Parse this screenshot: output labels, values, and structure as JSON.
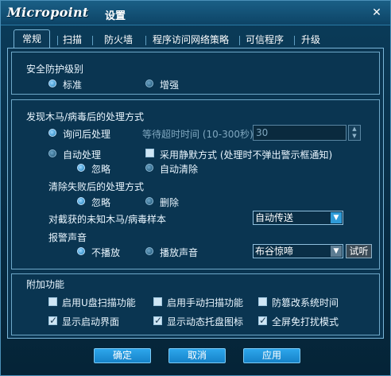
{
  "window": {
    "logo": "Micropoint",
    "title": "设置",
    "close": "✕"
  },
  "tabs": [
    "常规",
    "扫描",
    "防火墙",
    "程序访问网络策略",
    "可信程序",
    "升级"
  ],
  "security_level": {
    "heading": "安全防护级别",
    "options": [
      {
        "label": "标准",
        "selected": true
      },
      {
        "label": "增强",
        "selected": false
      }
    ]
  },
  "trojan_handling": {
    "heading": "发现木马/病毒后的处理方式",
    "ask": {
      "label": "询问后处理",
      "selected": true
    },
    "timeout": {
      "label": "等待超时时间 (10-300秒):",
      "value": "30"
    },
    "auto": {
      "label": "自动处理",
      "selected": false
    },
    "silent": {
      "label": "采用静默方式 (处理时不弹出警示框通知)",
      "checked": false
    },
    "ignore": {
      "label": "忽略",
      "selected": true
    },
    "auto_clear": {
      "label": "自动清除",
      "selected": false
    },
    "fail_heading": "清除失败后的处理方式",
    "fail_ignore": {
      "label": "忽略",
      "selected": true
    },
    "fail_delete": {
      "label": "删除",
      "selected": false
    },
    "unknown_label": "对截获的未知木马/病毒样本",
    "unknown_select": "自动传送",
    "alarm_heading": "报警声音",
    "no_sound": {
      "label": "不播放",
      "selected": true
    },
    "play_sound": {
      "label": "播放声音",
      "selected": false
    },
    "sound_select": "布谷惊啼",
    "listen": "试听"
  },
  "extras": {
    "heading": "附加功能",
    "items": [
      {
        "label": "启用U盘扫描功能",
        "checked": false
      },
      {
        "label": "启用手动扫描功能",
        "checked": false
      },
      {
        "label": "防篡改系统时间",
        "checked": false
      },
      {
        "label": "显示启动界面",
        "checked": true
      },
      {
        "label": "显示动态托盘图标",
        "checked": true
      },
      {
        "label": "全屏免打扰模式",
        "checked": true
      }
    ]
  },
  "footer": {
    "ok": "确定",
    "cancel": "取消",
    "apply": "应用"
  },
  "colors": {
    "background": "#072c44",
    "accent": "#2f9bd8",
    "border": "#7ab6d8"
  }
}
